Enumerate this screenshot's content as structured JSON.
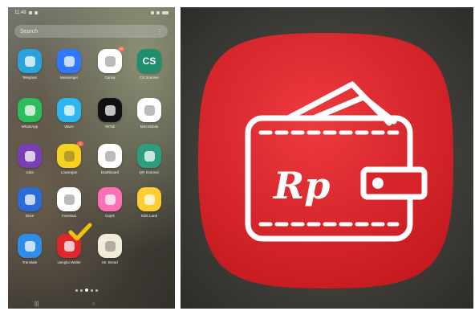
{
  "status_bar": {
    "time": "11:48"
  },
  "search": {
    "placeholder": "Search",
    "menu_glyph": "⋮"
  },
  "apps": [
    {
      "label": "Telegram",
      "icon": "telegram-icon",
      "bg": "#2aa3dd"
    },
    {
      "label": "Messenger",
      "icon": "messenger-icon",
      "bg": "#2f78ff"
    },
    {
      "label": "Canva",
      "icon": "canva-icon",
      "bg": "#ffffff",
      "badge": "20"
    },
    {
      "label": "CS Scanner",
      "icon": "camscanner-icon",
      "bg": "#1e8f6e",
      "text": "CS"
    },
    {
      "label": "WhatsApp",
      "icon": "wa-icon",
      "bg": "#2dbd5a"
    },
    {
      "label": "Waze",
      "icon": "waze-icon",
      "bg": "#2eb6f0"
    },
    {
      "label": "TikTok",
      "icon": "tiktok-icon",
      "bg": "#111111"
    },
    {
      "label": "MSI Mobile",
      "icon": "msi-icon",
      "bg": "#ffffff"
    },
    {
      "label": "Jobs",
      "icon": "jobs-icon",
      "bg": "#7b3fb5"
    },
    {
      "label": "Lowongan",
      "icon": "lowongan-icon",
      "bg": "#f5d21e",
      "badge": "1"
    },
    {
      "label": "Dashboard",
      "icon": "dashboard-icon",
      "bg": "#ffffff"
    },
    {
      "label": "QR Scanner",
      "icon": "qr-icon",
      "bg": "#2e9c7f"
    },
    {
      "label": "Drive",
      "icon": "drive-icon",
      "bg": "#2a6dd9"
    },
    {
      "label": "Investasi",
      "icon": "invest-icon",
      "bg": "#ffffff"
    },
    {
      "label": "Gojek",
      "icon": "game-icon",
      "bg": "#ff6fb5"
    },
    {
      "label": "Kids Land",
      "icon": "kids-icon",
      "bg": "#ffcc33"
    },
    {
      "label": "Translate",
      "icon": "translate-icon",
      "bg": "#2e8de6"
    },
    {
      "label": "Uangku Wallet",
      "icon": "wallet-icon",
      "bg": "#e0262b",
      "checked": true
    },
    {
      "label": "Mr. Bread",
      "icon": "bread-icon",
      "bg": "#f0ecd8"
    }
  ],
  "big_icon": {
    "currency_text": "Rp",
    "icon": "wallet-icon",
    "bg_top": "#ee3a3f",
    "bg_bottom": "#c3181d"
  },
  "colors": {
    "check": "#f2c20e",
    "wallet_red": "#e0262b"
  }
}
